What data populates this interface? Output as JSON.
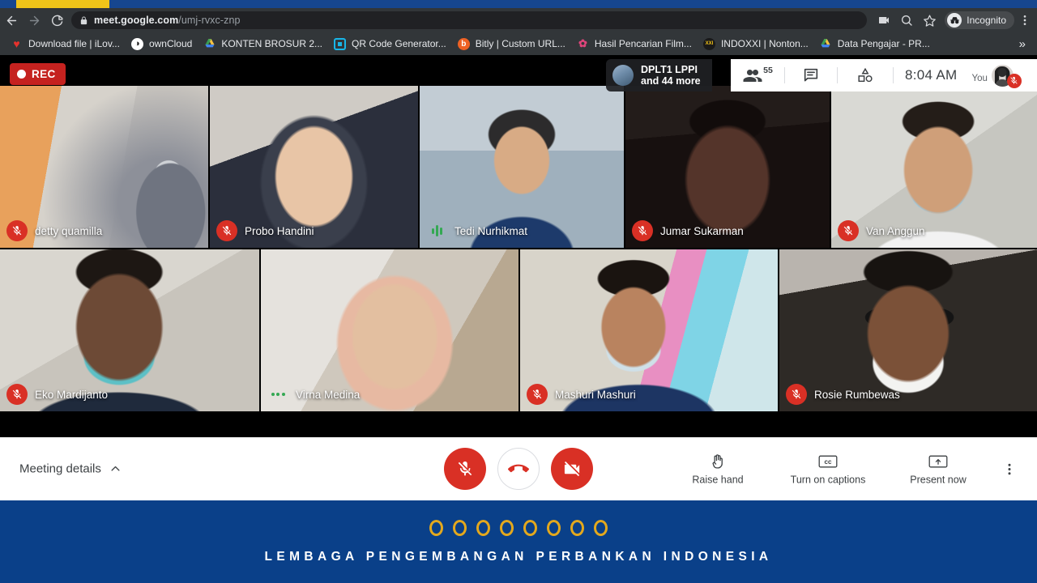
{
  "browser": {
    "back_icon": "back-arrow-icon",
    "forward_icon": "forward-arrow-icon",
    "reload_icon": "reload-icon",
    "url_domain": "meet.google.com",
    "url_path": "/umj-rvxc-znp",
    "lock_icon": "lock-icon",
    "cast_icon": "cast-icon",
    "search_icon": "search-icon",
    "bookmark_star_icon": "star-icon",
    "incognito_label": "Incognito",
    "menu_icon": "three-dot-menu-icon",
    "bookmarks": [
      {
        "label": "Download file | iLov...",
        "icon": "ilovepdf-heart-icon",
        "color": "#e5322d",
        "glyph": "♥"
      },
      {
        "label": "ownCloud",
        "icon": "owncloud-icon",
        "color": "#ffffff",
        "glyph": "◑"
      },
      {
        "label": "KONTEN BROSUR 2...",
        "icon": "google-drive-icon",
        "color": "#f6c344",
        "glyph": "▲"
      },
      {
        "label": "QR Code Generator...",
        "icon": "qr-code-icon",
        "color": "#18b6e8",
        "glyph": "▣"
      },
      {
        "label": "Bitly | Custom URL...",
        "icon": "bitly-icon",
        "color": "#ee6123",
        "glyph": "b"
      },
      {
        "label": "Hasil Pencarian Film...",
        "icon": "flower-icon",
        "color": "#e0457b",
        "glyph": "✿"
      },
      {
        "label": "INDOXXI | Nonton...",
        "icon": "indoxxi-icon",
        "color": "#f5c518",
        "glyph": "XXI"
      },
      {
        "label": "Data Pengajar - PR...",
        "icon": "google-drive-icon",
        "color": "#3aa757",
        "glyph": "▲"
      }
    ],
    "bookmark_overflow": "»"
  },
  "meet": {
    "recording": {
      "label": "REC",
      "dot_icon": "record-dot-icon",
      "color": "#c5221f"
    },
    "meeting_chip": {
      "title": "DPLT1 LPPI",
      "subtitle": "and 44 more",
      "thumb_icon": "meeting-thumbnail-icon"
    },
    "topbar": {
      "participants_icon": "people-icon",
      "participant_count": "55",
      "chat_icon": "chat-bubble-icon",
      "activities_icon": "activities-shapes-icon",
      "time": "8:04  AM",
      "self_label": "You",
      "self_avatar_icon": "user-avatar",
      "self_mute_icon": "mic-off-icon"
    },
    "participants": [
      {
        "name": "detty quamilla",
        "audio": "muted"
      },
      {
        "name": "Probo Handini",
        "audio": "muted"
      },
      {
        "name": "Tedi Nurhikmat",
        "audio": "speaking"
      },
      {
        "name": "Jumar Sukarman",
        "audio": "muted"
      },
      {
        "name": "Van Anggun",
        "audio": "muted"
      },
      {
        "name": "Eko Mardijanto",
        "audio": "muted"
      },
      {
        "name": "Virna Medina",
        "audio": "active"
      },
      {
        "name": "Mashuri Mashuri",
        "audio": "muted"
      },
      {
        "name": "Rosie Rumbewas",
        "audio": "muted"
      }
    ],
    "controls": {
      "meeting_details_label": "Meeting details",
      "meeting_details_chevron_icon": "chevron-up-icon",
      "mic_button_icon": "mic-off-icon",
      "hangup_button_icon": "hangup-phone-icon",
      "camera_button_icon": "camera-off-icon",
      "raise_hand_label": "Raise hand",
      "raise_hand_icon": "raised-hand-icon",
      "captions_label": "Turn on captions",
      "captions_icon": "closed-captions-icon",
      "present_label": "Present now",
      "present_icon": "present-screen-icon",
      "more_options_icon": "three-dot-menu-icon"
    }
  },
  "footer": {
    "org_name": "LEMBAGA PENGEMBANGAN PERBANKAN INDONESIA",
    "dot_count": 8,
    "dot_color": "#e3a81d",
    "background_color": "#0a4089"
  }
}
